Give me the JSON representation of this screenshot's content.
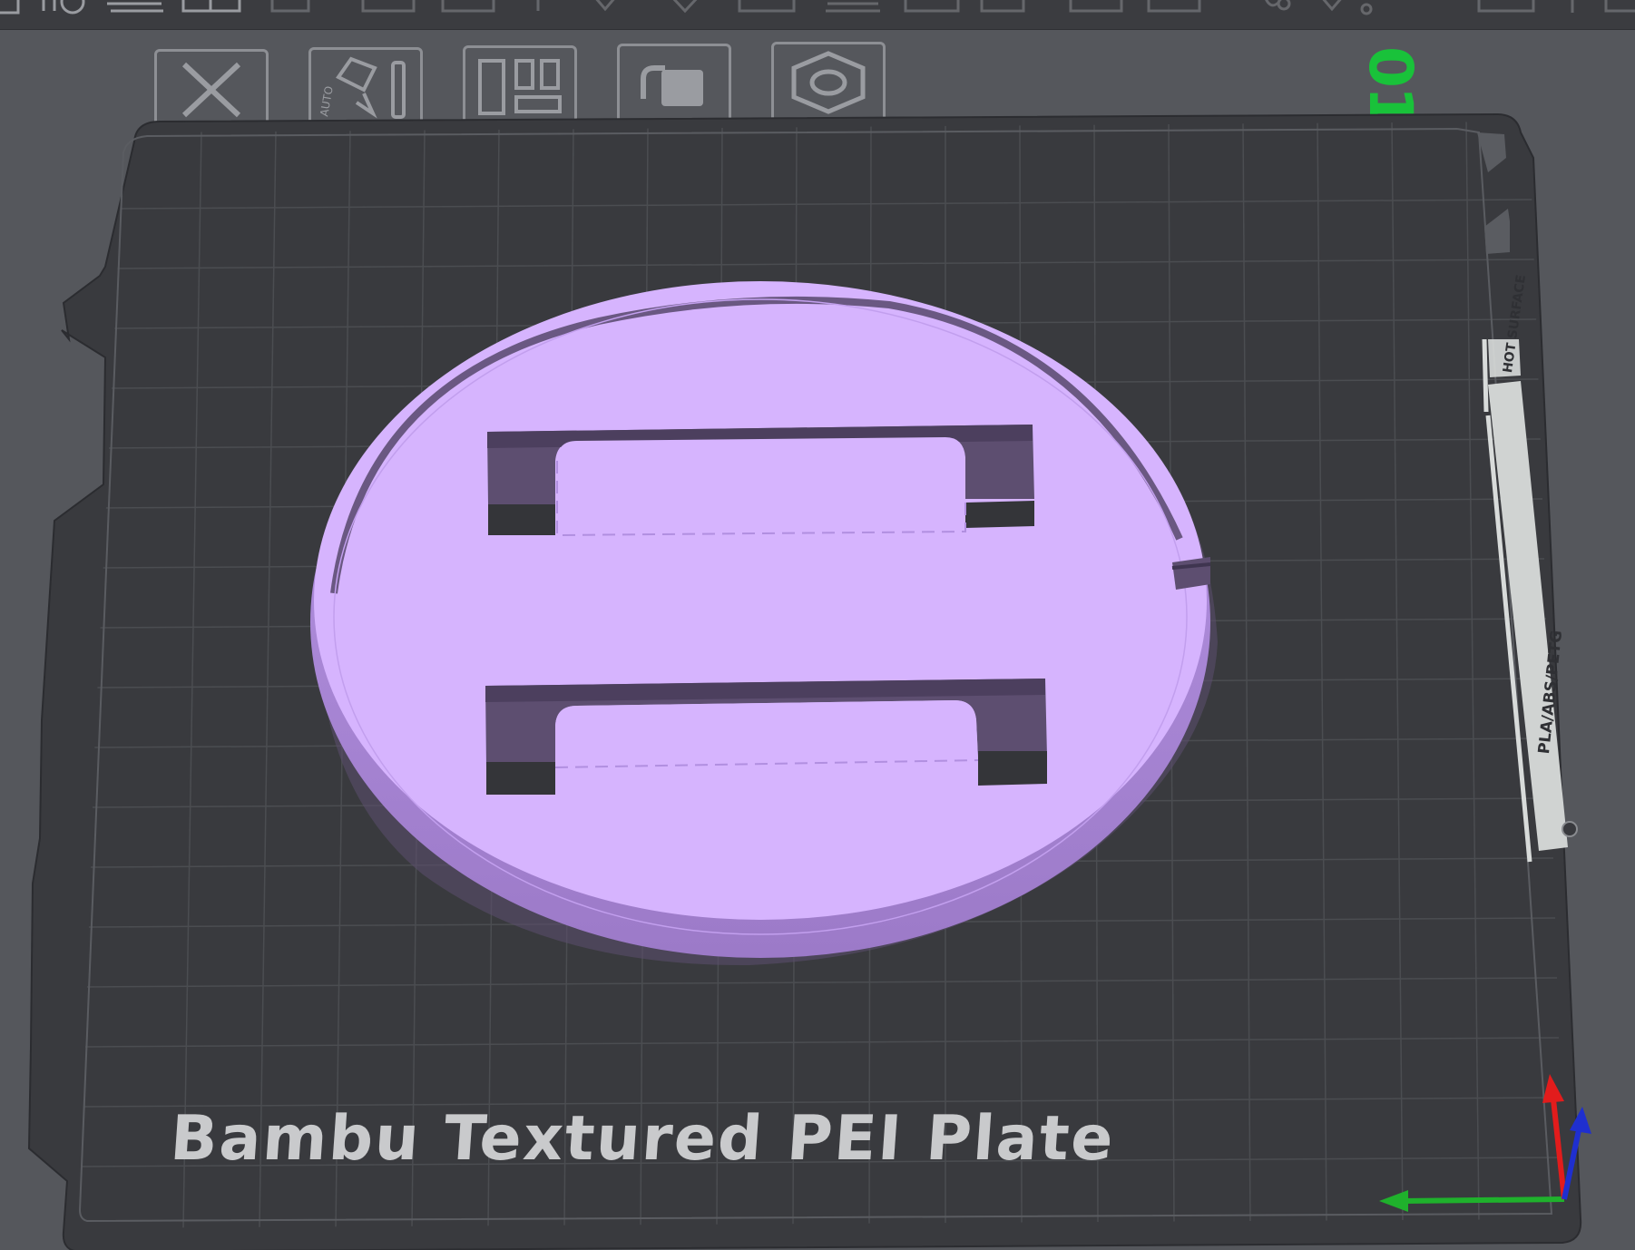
{
  "toolbar": {
    "icons": [
      "add-icon",
      "add-plate-icon",
      "orient-icon",
      "arrange-icon",
      "split-icon",
      "layers-icon",
      "move-icon",
      "rotate-icon",
      "scale-icon",
      "cut-icon",
      "support-icon",
      "seam-icon",
      "text-icon",
      "measure-icon",
      "assemble-icon",
      "variable-layer-icon"
    ]
  },
  "plate_toolbar": {
    "buttons": [
      {
        "name": "remove-plate-button",
        "icon": "close-icon"
      },
      {
        "name": "auto-orient-plate-button",
        "icon": "auto-orient-icon",
        "label": "AUTO"
      },
      {
        "name": "arrange-plate-button",
        "icon": "arrange-icon"
      },
      {
        "name": "lock-plate-button",
        "icon": "lock-icon"
      },
      {
        "name": "plate-settings-button",
        "icon": "hexagon-nut-icon"
      }
    ]
  },
  "plate": {
    "number": "01",
    "label": "Bambu Textured PEI Plate",
    "strip_warning": "HOT SURFACE",
    "strip_materials": "PLA/ABS/PETG"
  },
  "colors": {
    "background": "#55575c",
    "bed": "#393a3e",
    "grid": "#4b4d51",
    "model": "#d6b4fe",
    "model_side": "#b08ede",
    "model_shadow": "#5d4e70",
    "plate_number": "#19c23a",
    "axis_x": "#e21c1c",
    "axis_y": "#1fb12c",
    "axis_z": "#1f2fcf"
  }
}
